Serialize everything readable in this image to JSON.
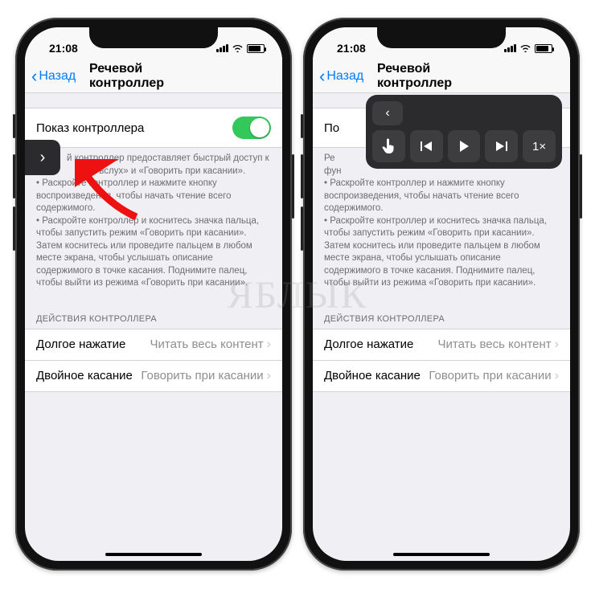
{
  "status": {
    "time": "21:08"
  },
  "nav": {
    "back": "Назад",
    "title": "Речевой контроллер"
  },
  "toggle": {
    "label": "Показ контроллера"
  },
  "help": {
    "line1_partial": "й контроллер предоставляет быстрый доступ к",
    "line1_full": "Речевой контроллер предоставляет быстрый доступ к функциям «Экран вслух» и «Говорить при касании».",
    "line2_partial": "ран вслух» и «Говорить при касании».",
    "bullet1_partial": " • Раскройте контроллер и нажмите кнопку воспроизведения, чтобы начать чтение всего содержимого.",
    "bullet1_full": " • Раскройте контроллер и нажмите кнопку воспроизведения, чтобы начать чтение всего содержимого.",
    "bullet2": " • Раскройте контроллер и коснитесь значка пальца, чтобы запустить режим «Говорить при касании». Затем коснитесь или проведите пальцем в любом месте экрана, чтобы услышать описание содержимого в точке касания. Поднимите палец, чтобы выйти из режима «Говорить при касании»."
  },
  "section": {
    "actions": "ДЕЙСТВИЯ КОНТРОЛЛЕРА"
  },
  "rows": {
    "long_press": {
      "label": "Долгое нажатие",
      "value": "Читать весь контент"
    },
    "double_tap": {
      "label": "Двойное касание",
      "value": "Говорить при касании"
    }
  },
  "expanded": {
    "speed": "1×"
  },
  "watermark": "ЯБЛЫК"
}
